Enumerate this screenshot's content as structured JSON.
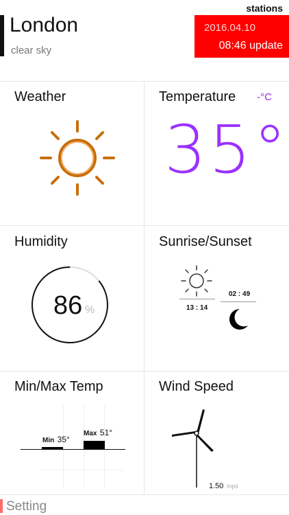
{
  "header": {
    "city": "London",
    "condition": "clear sky",
    "stations_label": "stations",
    "date": "2016.04.10",
    "update": "08:46 update"
  },
  "tiles": {
    "weather": {
      "title": "Weather",
      "icon": "sun-icon",
      "color": "#c86e0a"
    },
    "temperature": {
      "title": "Temperature",
      "unit": "-°C",
      "value": "35°",
      "color": "#9b30ff"
    },
    "humidity": {
      "title": "Humidity",
      "value": "86",
      "unit": "%",
      "fraction": 0.86
    },
    "sun": {
      "title": "Sunrise/Sunset",
      "sunrise": "13 : 14",
      "sunset": "02 : 49"
    },
    "minmax": {
      "title": "Min/Max Temp",
      "min_label": "Min",
      "min_value": "35°",
      "max_label": "Max",
      "max_value": "51°"
    },
    "wind": {
      "title": "Wind Speed",
      "value": "1.50",
      "unit": "mps",
      "icon": "wind-turbine-icon"
    }
  },
  "footer": {
    "setting_label": "Setting"
  },
  "colors": {
    "accent_red": "#ff0000",
    "purple": "#9b30ff",
    "sun_orange": "#c86e0a"
  }
}
